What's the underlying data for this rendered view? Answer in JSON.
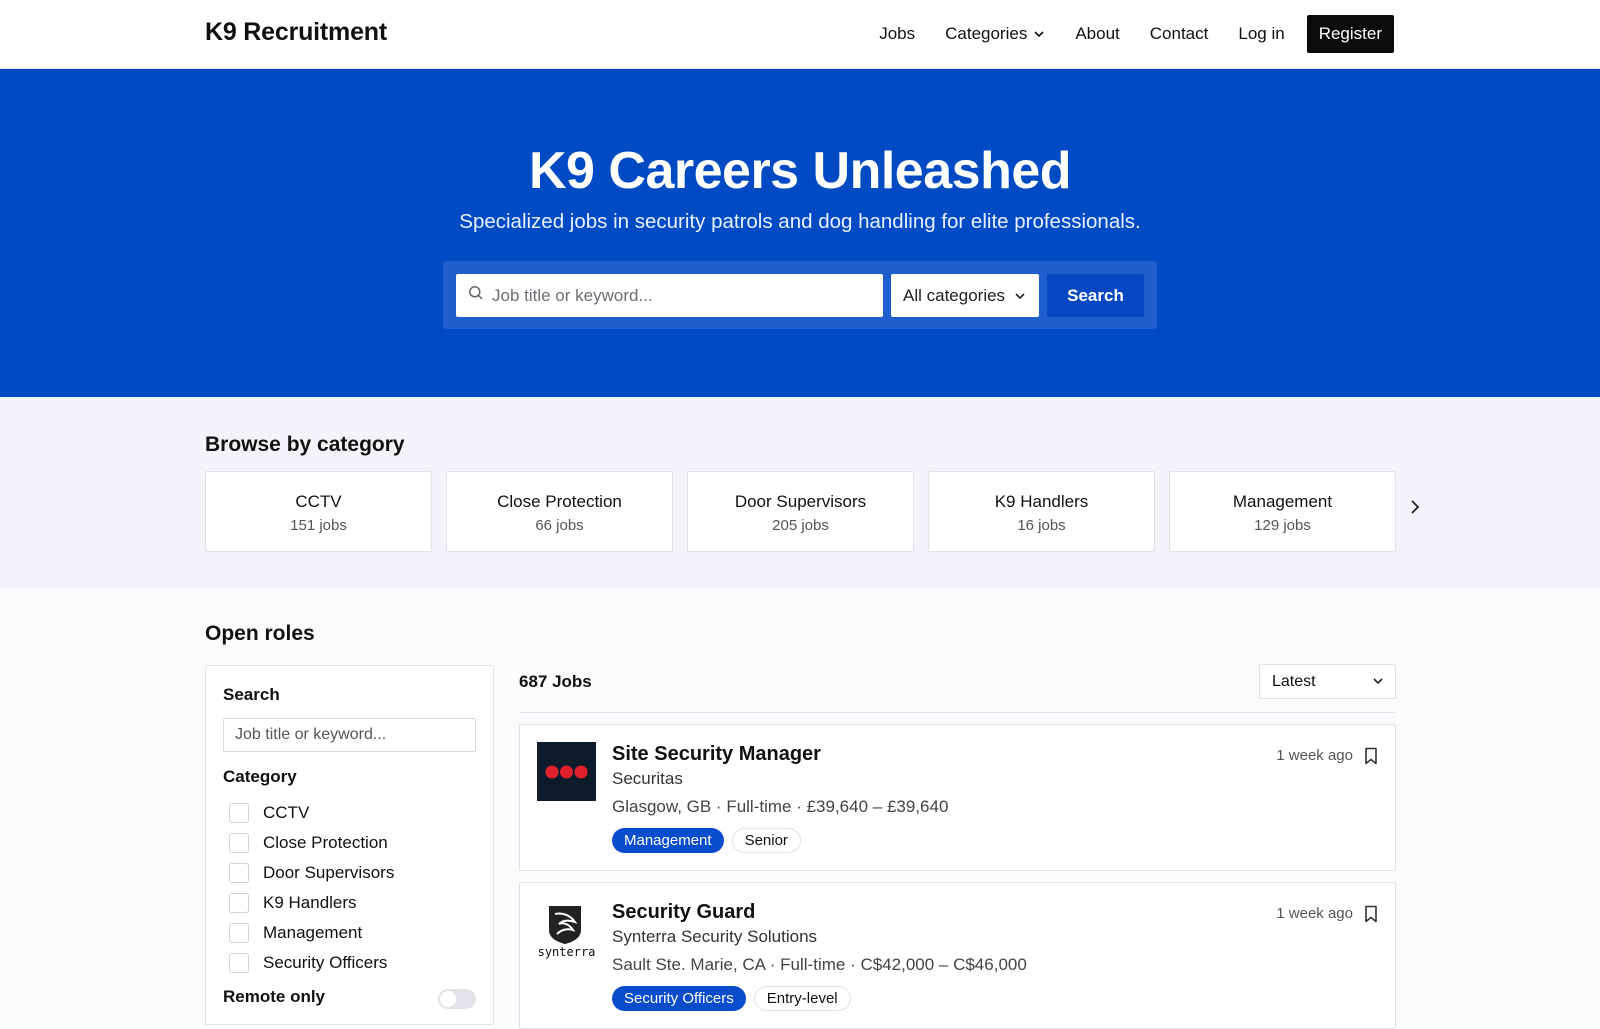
{
  "nav": {
    "brand": "K9 Recruitment",
    "links": {
      "jobs": "Jobs",
      "categories": "Categories",
      "about": "About",
      "contact": "Contact",
      "login": "Log in"
    },
    "register": "Register"
  },
  "hero": {
    "title": "K9 Careers Unleashed",
    "subtitle": "Specialized jobs in security patrols and dog handling for elite professionals.",
    "search_placeholder": "Job title or keyword...",
    "category_select": "All categories",
    "search_button": "Search"
  },
  "browse": {
    "title": "Browse by category",
    "categories": [
      {
        "name": "CCTV",
        "count": "151 jobs"
      },
      {
        "name": "Close Protection",
        "count": "66 jobs"
      },
      {
        "name": "Door Supervisors",
        "count": "205 jobs"
      },
      {
        "name": "K9 Handlers",
        "count": "16 jobs"
      },
      {
        "name": "Management",
        "count": "129 jobs"
      }
    ]
  },
  "roles": {
    "title": "Open roles",
    "filters": {
      "search_label": "Search",
      "search_placeholder": "Job title or keyword...",
      "category_label": "Category",
      "categories": [
        "CCTV",
        "Close Protection",
        "Door Supervisors",
        "K9 Handlers",
        "Management",
        "Security Officers"
      ],
      "remote_label": "Remote only"
    },
    "count": "687 Jobs",
    "sort": "Latest",
    "jobs": [
      {
        "title": "Site Security Manager",
        "company": "Securitas",
        "meta": "Glasgow, GB · Full-time · £39,640 – £39,640",
        "tags": [
          "Management",
          "Senior"
        ],
        "age": "1 week ago",
        "logo_text": ""
      },
      {
        "title": "Security Guard",
        "company": "Synterra Security Solutions",
        "meta": "Sault Ste. Marie, CA · Full-time · C$42,000 – C$46,000",
        "tags": [
          "Security Officers",
          "Entry-level"
        ],
        "age": "1 week ago",
        "logo_text": "synterra"
      }
    ]
  },
  "colors": {
    "brand_blue": "#004bc4",
    "accent_blue": "#0a4dcc",
    "dark": "#0b0b0d",
    "securitas_red": "#e2202c"
  }
}
